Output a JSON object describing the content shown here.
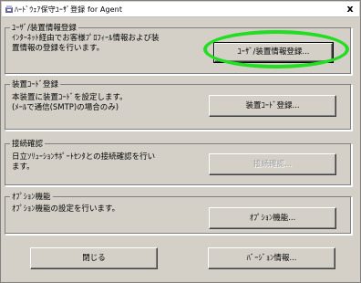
{
  "window": {
    "title": "ﾊｰﾄﾞｳｪｱ保守ﾕｰｻﾞ登録 for Agent",
    "close_symbol": "x",
    "icon": "app-icon"
  },
  "groups": [
    {
      "legend": "ﾕｰｻﾞ/装置情報登録",
      "description": "ｲﾝﾀｰﾈｯﾄ経由でお客様ﾌﾟﾛﾌｨｰﾙ情報および装\n置情報の登録を行います。",
      "button_label": "ﾕｰｻﾞ/装置情報登録..."
    },
    {
      "legend": "装置ｺｰﾄﾞ登録",
      "description": "本装置に装置ｺｰﾄﾞを設定します。\n(ﾒｰﾙで通信(SMTP)の場合のみ)",
      "button_label": "装置ｺｰﾄﾞ登録..."
    },
    {
      "legend": "接続確認",
      "description": "日立ｿﾘｭｰｼｮﾝｻﾎﾟｰﾄｾﾝﾀとの接続確認を行い\nます。",
      "button_label": "接続確認..."
    },
    {
      "legend": "ｵﾌﾟｼｮﾝ機能",
      "description": "ｵﾌﾟｼｮﾝ機能の設定を行います。",
      "button_label": "ｵﾌﾟｼｮﾝ機能..."
    }
  ],
  "footer": {
    "close_label": "閉じる",
    "version_label": "ﾊﾞｰｼﾞｮﾝ情報..."
  },
  "colors": {
    "highlight": "#22dd22",
    "face": "#d4d0c8"
  }
}
